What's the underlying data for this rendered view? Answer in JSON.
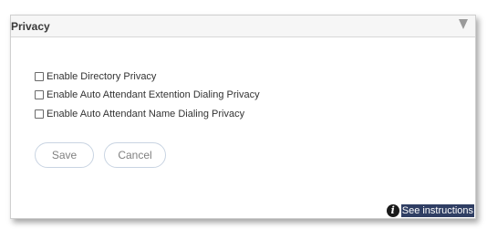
{
  "panel": {
    "title": "Privacy"
  },
  "options": [
    {
      "label": "Enable Directory Privacy",
      "checked": false
    },
    {
      "label": "Enable Auto Attendant Extention Dialing Privacy",
      "checked": false
    },
    {
      "label": "Enable Auto Attendant Name Dialing Privacy",
      "checked": false
    }
  ],
  "buttons": {
    "save_label": "Save",
    "cancel_label": "Cancel"
  },
  "instructions": {
    "label": "See instructions",
    "icon": "info-icon"
  }
}
